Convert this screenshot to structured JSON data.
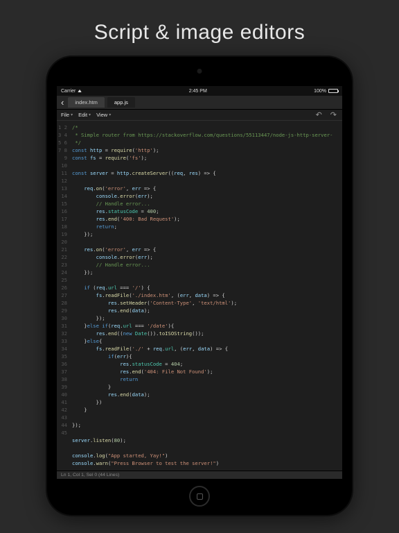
{
  "headline": "Script & image editors",
  "statusbar": {
    "carrier": "Carrier",
    "time": "2:45 PM",
    "battery": "100%"
  },
  "tabs": {
    "back": "‹",
    "items": [
      {
        "label": "index.htm",
        "active": false
      },
      {
        "label": "app.js",
        "active": true
      }
    ]
  },
  "menu": {
    "file": "File",
    "edit": "Edit",
    "view": "View",
    "dd": "▾",
    "undo": "↶",
    "redo": "↷"
  },
  "status": "Ln 1, Col 1, Sel 0 (44 Lines)",
  "code": {
    "lines": 44,
    "tokens": [
      [
        [
          "cm",
          "/*"
        ]
      ],
      [
        [
          "cm",
          " * Simple router from https://stackoverflow.com/questions/55113447/node-js-http-server-"
        ]
      ],
      [
        [
          "cm",
          " */"
        ]
      ],
      [
        [
          "kw",
          "const"
        ],
        [
          "pn",
          " "
        ],
        [
          "id",
          "http"
        ],
        [
          "pn",
          " = "
        ],
        [
          "fn",
          "require"
        ],
        [
          "pn",
          "("
        ],
        [
          "st",
          "'http'"
        ],
        [
          "pn",
          ");"
        ]
      ],
      [
        [
          "kw",
          "const"
        ],
        [
          "pn",
          " "
        ],
        [
          "id",
          "fs"
        ],
        [
          "pn",
          " = "
        ],
        [
          "fn",
          "require"
        ],
        [
          "pn",
          "("
        ],
        [
          "st",
          "'fs'"
        ],
        [
          "pn",
          ");"
        ]
      ],
      [],
      [
        [
          "kw",
          "const"
        ],
        [
          "pn",
          " "
        ],
        [
          "id",
          "server"
        ],
        [
          "pn",
          " = "
        ],
        [
          "id",
          "http"
        ],
        [
          "pn",
          "."
        ],
        [
          "fn",
          "createServer"
        ],
        [
          "pn",
          "(("
        ],
        [
          "id",
          "req"
        ],
        [
          "pn",
          ", "
        ],
        [
          "id",
          "res"
        ],
        [
          "pn",
          ") => {"
        ]
      ],
      [],
      [
        [
          "pn",
          "    "
        ],
        [
          "id",
          "req"
        ],
        [
          "pn",
          "."
        ],
        [
          "fn",
          "on"
        ],
        [
          "pn",
          "("
        ],
        [
          "st",
          "'error'"
        ],
        [
          "pn",
          ", "
        ],
        [
          "id",
          "err"
        ],
        [
          "pn",
          " => {"
        ]
      ],
      [
        [
          "pn",
          "        "
        ],
        [
          "id",
          "console"
        ],
        [
          "pn",
          "."
        ],
        [
          "fn",
          "error"
        ],
        [
          "pn",
          "("
        ],
        [
          "id",
          "err"
        ],
        [
          "pn",
          ");"
        ]
      ],
      [
        [
          "pn",
          "        "
        ],
        [
          "cm",
          "// Handle error..."
        ]
      ],
      [
        [
          "pn",
          "        "
        ],
        [
          "id",
          "res"
        ],
        [
          "pn",
          "."
        ],
        [
          "pr",
          "statusCode"
        ],
        [
          "pn",
          " = "
        ],
        [
          "nm",
          "400"
        ],
        [
          "pn",
          ";"
        ]
      ],
      [
        [
          "pn",
          "        "
        ],
        [
          "id",
          "res"
        ],
        [
          "pn",
          "."
        ],
        [
          "fn",
          "end"
        ],
        [
          "pn",
          "("
        ],
        [
          "st",
          "'400: Bad Request'"
        ],
        [
          "pn",
          ");"
        ]
      ],
      [
        [
          "pn",
          "        "
        ],
        [
          "kw",
          "return"
        ],
        [
          "pn",
          ";"
        ]
      ],
      [
        [
          "pn",
          "    });"
        ]
      ],
      [],
      [
        [
          "pn",
          "    "
        ],
        [
          "id",
          "res"
        ],
        [
          "pn",
          "."
        ],
        [
          "fn",
          "on"
        ],
        [
          "pn",
          "("
        ],
        [
          "st",
          "'error'"
        ],
        [
          "pn",
          ", "
        ],
        [
          "id",
          "err"
        ],
        [
          "pn",
          " => {"
        ]
      ],
      [
        [
          "pn",
          "        "
        ],
        [
          "id",
          "console"
        ],
        [
          "pn",
          "."
        ],
        [
          "fn",
          "error"
        ],
        [
          "pn",
          "("
        ],
        [
          "id",
          "err"
        ],
        [
          "pn",
          ");"
        ]
      ],
      [
        [
          "pn",
          "        "
        ],
        [
          "cm",
          "// Handle error..."
        ]
      ],
      [
        [
          "pn",
          "    });"
        ]
      ],
      [],
      [
        [
          "pn",
          "    "
        ],
        [
          "kw",
          "if"
        ],
        [
          "pn",
          " ("
        ],
        [
          "id",
          "req"
        ],
        [
          "pn",
          "."
        ],
        [
          "pr",
          "url"
        ],
        [
          "pn",
          " === "
        ],
        [
          "st",
          "'/'"
        ],
        [
          "pn",
          ") {"
        ]
      ],
      [
        [
          "pn",
          "        "
        ],
        [
          "id",
          "fs"
        ],
        [
          "pn",
          "."
        ],
        [
          "fn",
          "readFile"
        ],
        [
          "pn",
          "("
        ],
        [
          "st",
          "'./index.htm'"
        ],
        [
          "pn",
          ", ("
        ],
        [
          "id",
          "err"
        ],
        [
          "pn",
          ", "
        ],
        [
          "id",
          "data"
        ],
        [
          "pn",
          ") => {"
        ]
      ],
      [
        [
          "pn",
          "            "
        ],
        [
          "id",
          "res"
        ],
        [
          "pn",
          "."
        ],
        [
          "fn",
          "setHeader"
        ],
        [
          "pn",
          "("
        ],
        [
          "st",
          "'Content-Type'"
        ],
        [
          "pn",
          ", "
        ],
        [
          "st",
          "'text/html'"
        ],
        [
          "pn",
          ");"
        ]
      ],
      [
        [
          "pn",
          "            "
        ],
        [
          "id",
          "res"
        ],
        [
          "pn",
          "."
        ],
        [
          "fn",
          "end"
        ],
        [
          "pn",
          "("
        ],
        [
          "id",
          "data"
        ],
        [
          "pn",
          ");"
        ]
      ],
      [
        [
          "pn",
          "        });"
        ]
      ],
      [
        [
          "pn",
          "    }"
        ],
        [
          "kw",
          "else if"
        ],
        [
          "pn",
          "("
        ],
        [
          "id",
          "req"
        ],
        [
          "pn",
          "."
        ],
        [
          "pr",
          "url"
        ],
        [
          "pn",
          " === "
        ],
        [
          "st",
          "'/date'"
        ],
        [
          "pn",
          "){"
        ]
      ],
      [
        [
          "pn",
          "        "
        ],
        [
          "id",
          "res"
        ],
        [
          "pn",
          "."
        ],
        [
          "fn",
          "end"
        ],
        [
          "pn",
          "(("
        ],
        [
          "kw",
          "new"
        ],
        [
          "pn",
          " "
        ],
        [
          "pr",
          "Date"
        ],
        [
          "pn",
          "())."
        ],
        [
          "fn",
          "toISOString"
        ],
        [
          "pn",
          "());"
        ]
      ],
      [
        [
          "pn",
          "    }"
        ],
        [
          "kw",
          "else"
        ],
        [
          "pn",
          "{"
        ]
      ],
      [
        [
          "pn",
          "        "
        ],
        [
          "id",
          "fs"
        ],
        [
          "pn",
          "."
        ],
        [
          "fn",
          "readFile"
        ],
        [
          "pn",
          "("
        ],
        [
          "st",
          "'./'"
        ],
        [
          "pn",
          " + "
        ],
        [
          "id",
          "req"
        ],
        [
          "pn",
          "."
        ],
        [
          "pr",
          "url"
        ],
        [
          "pn",
          ", ("
        ],
        [
          "id",
          "err"
        ],
        [
          "pn",
          ", "
        ],
        [
          "id",
          "data"
        ],
        [
          "pn",
          ") => {"
        ]
      ],
      [
        [
          "pn",
          "            "
        ],
        [
          "kw",
          "if"
        ],
        [
          "pn",
          "("
        ],
        [
          "id",
          "err"
        ],
        [
          "pn",
          "){"
        ]
      ],
      [
        [
          "pn",
          "                "
        ],
        [
          "id",
          "res"
        ],
        [
          "pn",
          "."
        ],
        [
          "pr",
          "statusCode"
        ],
        [
          "pn",
          " = "
        ],
        [
          "nm",
          "404"
        ],
        [
          "pn",
          ";"
        ]
      ],
      [
        [
          "pn",
          "                "
        ],
        [
          "id",
          "res"
        ],
        [
          "pn",
          "."
        ],
        [
          "fn",
          "end"
        ],
        [
          "pn",
          "("
        ],
        [
          "st",
          "'404: File Not Found'"
        ],
        [
          "pn",
          ");"
        ]
      ],
      [
        [
          "pn",
          "                "
        ],
        [
          "kw",
          "return"
        ]
      ],
      [
        [
          "pn",
          "            }"
        ]
      ],
      [
        [
          "pn",
          "            "
        ],
        [
          "id",
          "res"
        ],
        [
          "pn",
          "."
        ],
        [
          "fn",
          "end"
        ],
        [
          "pn",
          "("
        ],
        [
          "id",
          "data"
        ],
        [
          "pn",
          ");"
        ]
      ],
      [
        [
          "pn",
          "        })"
        ]
      ],
      [
        [
          "pn",
          "    }"
        ]
      ],
      [],
      [
        [
          "pn",
          "});"
        ]
      ],
      [],
      [
        [
          "id",
          "server"
        ],
        [
          "pn",
          "."
        ],
        [
          "fn",
          "listen"
        ],
        [
          "pn",
          "("
        ],
        [
          "nm",
          "80"
        ],
        [
          "pn",
          ");"
        ]
      ],
      [],
      [
        [
          "id",
          "console"
        ],
        [
          "pn",
          "."
        ],
        [
          "fn",
          "log"
        ],
        [
          "pn",
          "("
        ],
        [
          "st",
          "\"App started, Yay!\""
        ],
        [
          "pn",
          ")"
        ]
      ],
      [
        [
          "id",
          "console"
        ],
        [
          "pn",
          "."
        ],
        [
          "fn",
          "warn"
        ],
        [
          "pn",
          "("
        ],
        [
          "st",
          "\"Press Browser to test the server!\""
        ],
        [
          "pn",
          ")"
        ]
      ]
    ]
  }
}
